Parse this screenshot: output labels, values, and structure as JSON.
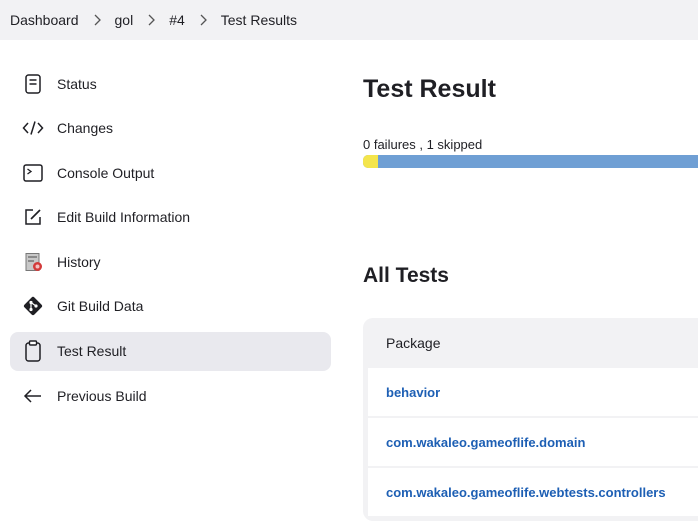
{
  "breadcrumb": [
    "Dashboard",
    "gol",
    "#4",
    "Test Results"
  ],
  "sidebar": {
    "items": [
      {
        "label": "Status",
        "icon": "status-icon"
      },
      {
        "label": "Changes",
        "icon": "code-icon"
      },
      {
        "label": "Console Output",
        "icon": "terminal-icon"
      },
      {
        "label": "Edit Build Information",
        "icon": "edit-icon"
      },
      {
        "label": "History",
        "icon": "history-icon"
      },
      {
        "label": "Git Build Data",
        "icon": "git-icon"
      },
      {
        "label": "Test Result",
        "icon": "clipboard-icon",
        "active": true
      },
      {
        "label": "Previous Build",
        "icon": "arrow-left-icon"
      }
    ]
  },
  "main": {
    "title": "Test Result",
    "summary": "0 failures , 1 skipped",
    "skipped_fraction": 0.045,
    "all_tests_title": "All Tests",
    "table": {
      "header": "Package",
      "rows": [
        "behavior",
        "com.wakaleo.gameoflife.domain",
        "com.wakaleo.gameoflife.webtests.controllers"
      ]
    }
  },
  "colors": {
    "passed": "#6f9fd4",
    "skipped": "#f4e54c",
    "link": "#1d5fb4",
    "active_bg": "#e9e9ee"
  }
}
